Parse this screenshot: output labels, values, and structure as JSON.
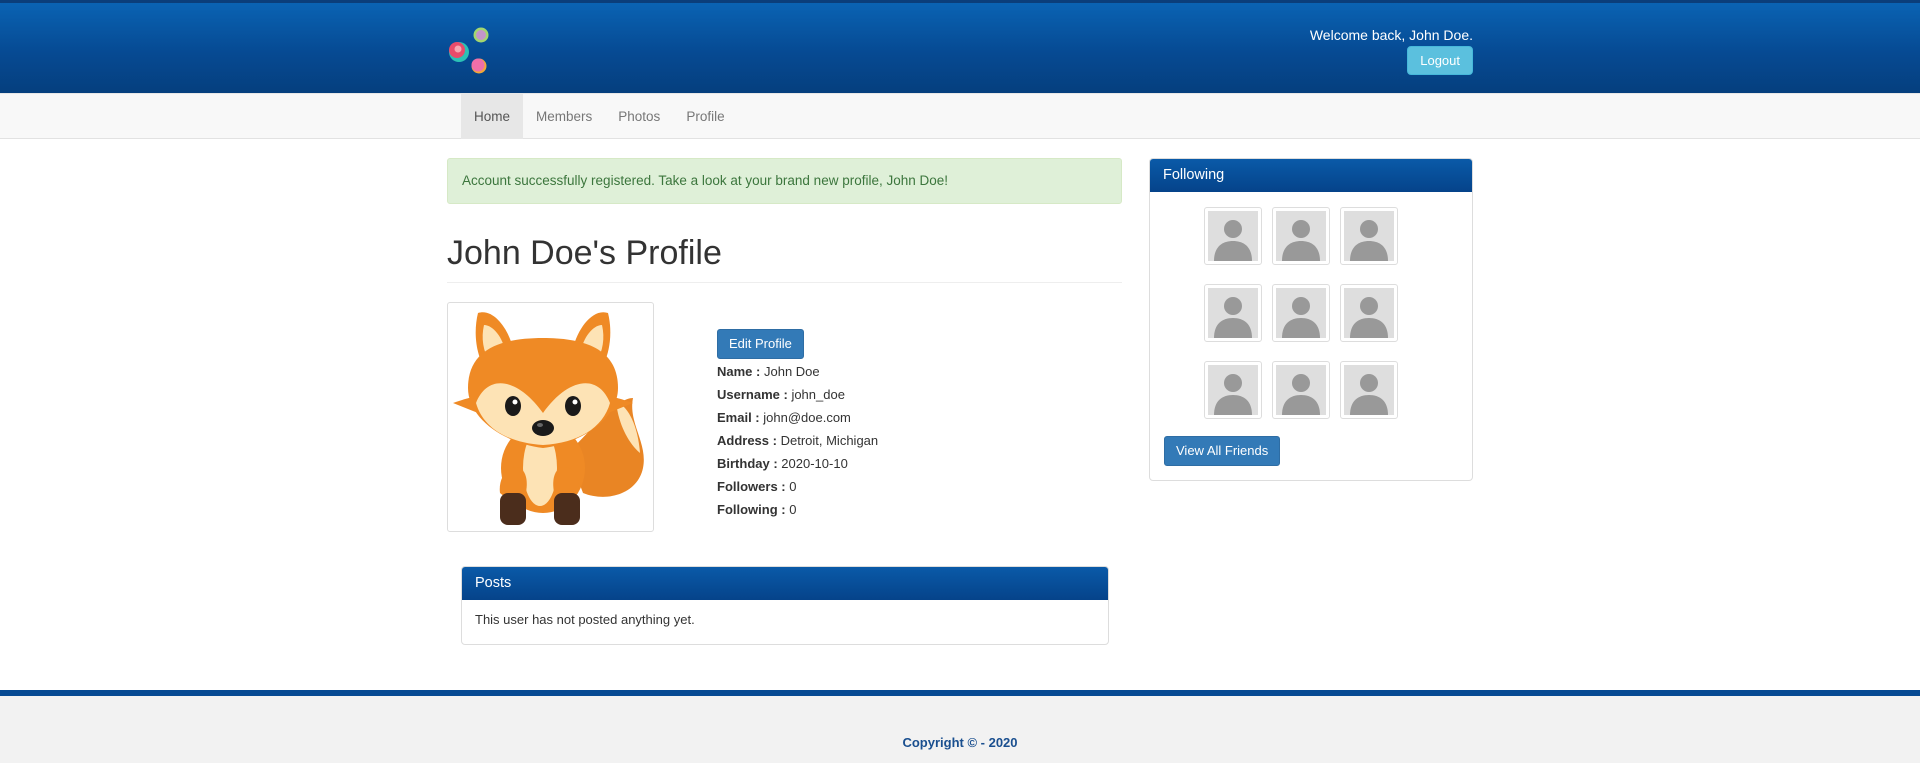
{
  "header": {
    "welcome": "Welcome back, John Doe.",
    "logout_label": "Logout",
    "brand_colors": [
      "#e84b6b",
      "#2cc1b5",
      "#b88ad6",
      "#f1a83a"
    ]
  },
  "nav": {
    "items": [
      {
        "label": "Home",
        "active": true
      },
      {
        "label": "Members"
      },
      {
        "label": "Photos"
      },
      {
        "label": "Profile"
      }
    ]
  },
  "alert": {
    "message": "Account successfully registered. Take a look at your brand new profile, John Doe!"
  },
  "profile": {
    "title": "John Doe's Profile",
    "edit_label": "Edit Profile",
    "avatar_icon": "fox-avatar-icon",
    "fields": [
      {
        "label": "Name :",
        "value": "John Doe"
      },
      {
        "label": "Username :",
        "value": "john_doe"
      },
      {
        "label": "Email :",
        "value": "john@doe.com"
      },
      {
        "label": "Address :",
        "value": "Detroit, Michigan"
      },
      {
        "label": "Birthday :",
        "value": "2020-10-10"
      },
      {
        "label": "Followers :",
        "value": "0"
      },
      {
        "label": "Following :",
        "value": "0"
      }
    ]
  },
  "posts": {
    "heading": "Posts",
    "empty_message": "This user has not posted anything yet."
  },
  "following": {
    "heading": "Following",
    "friend_icon": "user-placeholder-icon",
    "view_all_label": "View All Friends"
  },
  "footer": {
    "copyright": "Copyright © - 2020"
  },
  "colors": {
    "header_blue": "#064a93",
    "button_primary": "#337ab7",
    "button_info": "#5bc0de",
    "alert_success_bg": "#dff0d8"
  }
}
